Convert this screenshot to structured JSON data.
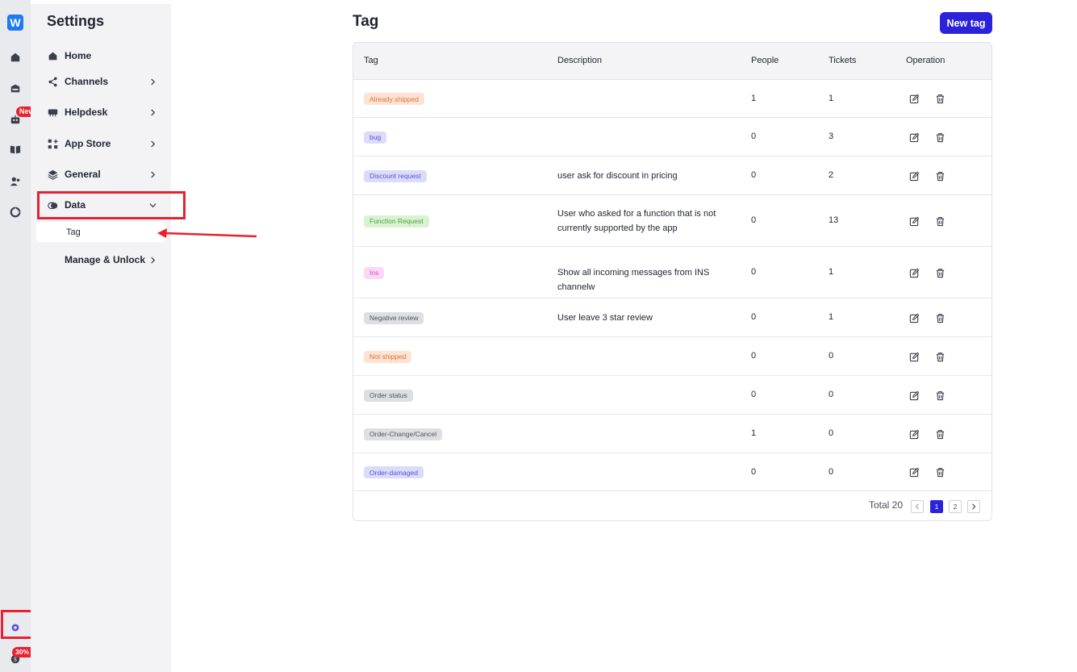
{
  "rail": {
    "logo": "W",
    "new_badge": "New",
    "off_badge": "30% OFF",
    "icons": [
      "home-icon",
      "inbox-icon",
      "bot-icon",
      "book-icon",
      "users-icon",
      "analytics-icon",
      "settings-icon",
      "billing-icon"
    ]
  },
  "sidebar": {
    "title": "Settings",
    "items": [
      {
        "label": "Home",
        "icon": "home-icon",
        "chevron": false
      },
      {
        "label": "Channels",
        "icon": "share-icon",
        "chevron": true
      },
      {
        "label": "Helpdesk",
        "icon": "helpdesk-icon",
        "chevron": true
      },
      {
        "label": "App Store",
        "icon": "apps-icon",
        "chevron": true
      },
      {
        "label": "General",
        "icon": "layers-icon",
        "chevron": true
      },
      {
        "label": "Data",
        "icon": "data-icon",
        "chevron": "down"
      },
      {
        "label": "Manage & Unlock",
        "icon": "",
        "chevron": true
      }
    ],
    "subitem": "Tag"
  },
  "main": {
    "title": "Tag",
    "new_button": "New tag",
    "columns": [
      "Tag",
      "Description",
      "People",
      "Tickets",
      "Operation"
    ],
    "rows": [
      {
        "tag": "Already shipped",
        "desc": "",
        "people": "1",
        "tickets": "1",
        "bg": "#fde3d4",
        "fg": "#e0713a"
      },
      {
        "tag": "bug",
        "desc": "",
        "people": "0",
        "tickets": "3",
        "bg": "#dcdcfa",
        "fg": "#5a52d6"
      },
      {
        "tag": "Discount request",
        "desc": "user ask for discount in pricing",
        "people": "0",
        "tickets": "2",
        "bg": "#dcdcfa",
        "fg": "#5a52d6"
      },
      {
        "tag": "Function Request",
        "desc": "User who asked for a function that is not currently supported by the app",
        "people": "0",
        "tickets": "13",
        "bg": "#d9f2d2",
        "fg": "#4fa43a"
      },
      {
        "tag": "Ins",
        "desc": "Show all incoming messages from INS channelw",
        "people": "0",
        "tickets": "1",
        "bg": "#fbd8f6",
        "fg": "#d24cc6"
      },
      {
        "tag": "Negative review",
        "desc": "User leave 3 star review",
        "people": "0",
        "tickets": "1",
        "bg": "#dedfe3",
        "fg": "#50545e"
      },
      {
        "tag": "Not shipped",
        "desc": "",
        "people": "0",
        "tickets": "0",
        "bg": "#fde3d4",
        "fg": "#e0713a"
      },
      {
        "tag": "Order status",
        "desc": "",
        "people": "0",
        "tickets": "0",
        "bg": "#dedfe3",
        "fg": "#50545e"
      },
      {
        "tag": "Order-Change/Cancel",
        "desc": "",
        "people": "1",
        "tickets": "0",
        "bg": "#dedfe3",
        "fg": "#50545e"
      },
      {
        "tag": "Order-damaged",
        "desc": "",
        "people": "0",
        "tickets": "0",
        "bg": "#dcdcfa",
        "fg": "#5a52d6"
      }
    ],
    "pagination": {
      "total": "Total 20",
      "pages": [
        "1",
        "2"
      ],
      "current": "1"
    }
  },
  "colors": {
    "accent": "#2b22d9",
    "annotation": "#e8212e"
  }
}
